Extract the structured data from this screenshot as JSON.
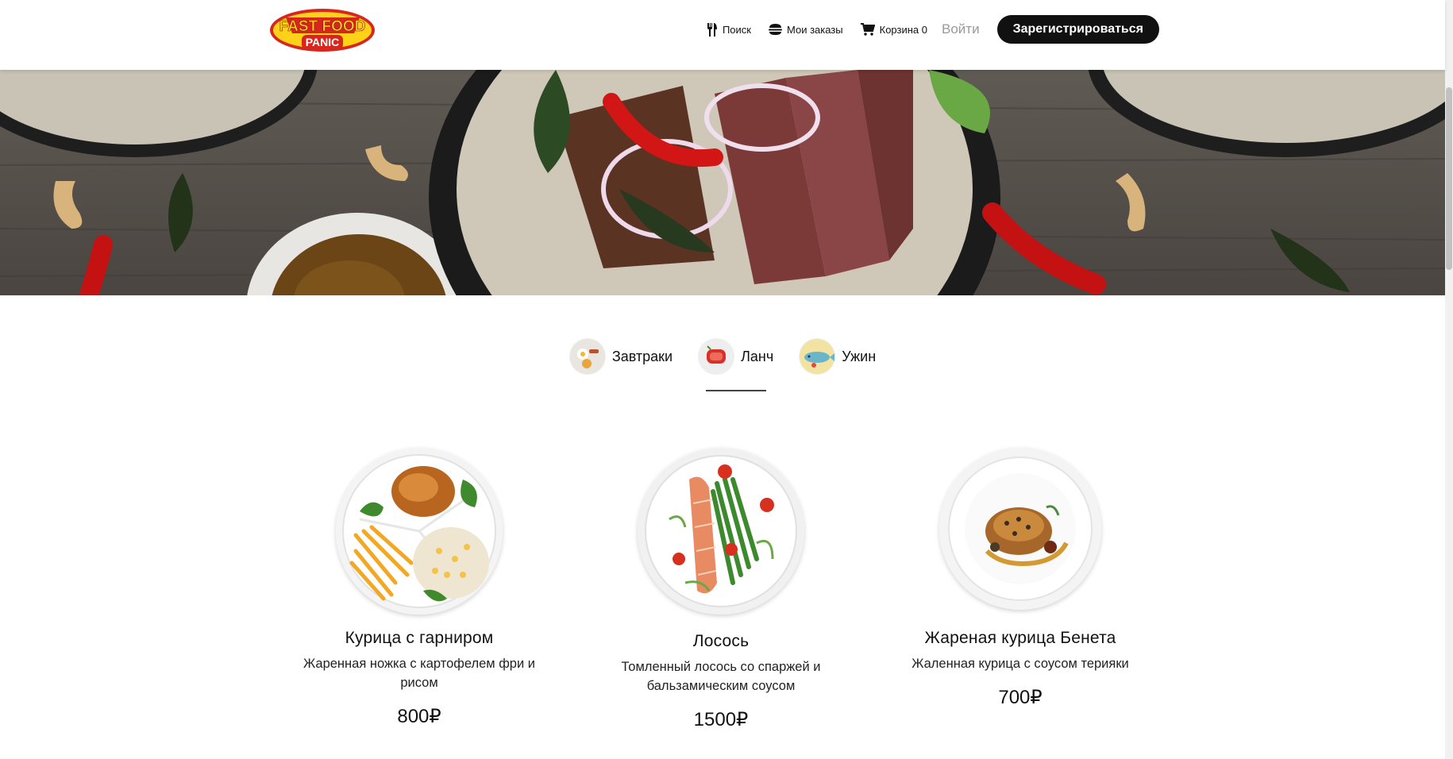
{
  "header": {
    "logo_text_top": "FAST FOOD",
    "logo_text_bottom": "PANIC",
    "nav": {
      "search_label": "Поиск",
      "orders_label": "Мои заказы",
      "cart_label": "Корзина 0",
      "login_label": "Войти",
      "register_label": "Зарегистрироваться"
    }
  },
  "tabs": [
    {
      "label": "Завтраки",
      "active": false
    },
    {
      "label": "Ланч",
      "active": true
    },
    {
      "label": "Ужин",
      "active": false
    }
  ],
  "menu": [
    {
      "title": "Курица с гарниром",
      "description": "Жаренная ножка с картофелем фри и рисом",
      "price": "800₽"
    },
    {
      "title": "Лосось",
      "description": "Томленный лосось со спаржей и бальзамическим соусом",
      "price": "1500₽"
    },
    {
      "title": "Жареная курица Бенета",
      "description": "Жаленная курица с соусом терияки",
      "price": "700₽"
    }
  ],
  "colors": {
    "accent_button": "#111111",
    "logo_red": "#d7261e",
    "logo_yellow": "#ffd21a"
  }
}
